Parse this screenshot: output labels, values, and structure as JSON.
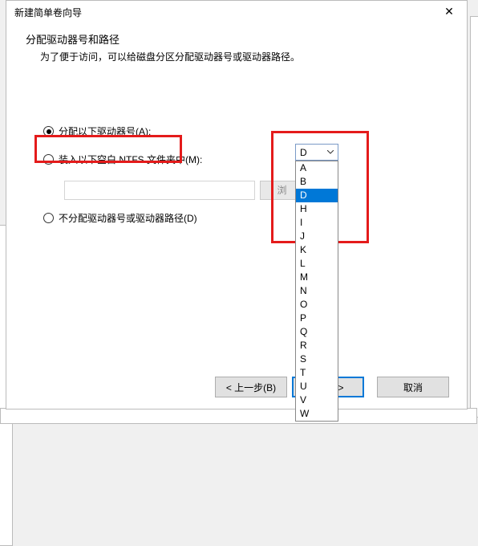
{
  "dialog": {
    "title": "新建简单卷向导",
    "close": "✕",
    "heading": "分配驱动器号和路径",
    "description": "为了便于访问，可以给磁盘分区分配驱动器号或驱动器路径。"
  },
  "options": {
    "assign": {
      "label": "分配以下驱动器号(A):",
      "checked": true
    },
    "mount": {
      "label": "装入以下空白 NTFS 文件夹中(M):",
      "checked": false
    },
    "none": {
      "label": "不分配驱动器号或驱动器路径(D)",
      "checked": false
    }
  },
  "browse": {
    "path_value": "",
    "button": "浏"
  },
  "drive_letter": {
    "selected": "D",
    "options": [
      "A",
      "B",
      "D",
      "H",
      "I",
      "J",
      "K",
      "L",
      "M",
      "N",
      "O",
      "P",
      "Q",
      "R",
      "S",
      "T",
      "U",
      "V",
      "W"
    ]
  },
  "footer": {
    "back": "< 上一步(B)",
    "next": "步(N) >",
    "cancel": "取消"
  }
}
